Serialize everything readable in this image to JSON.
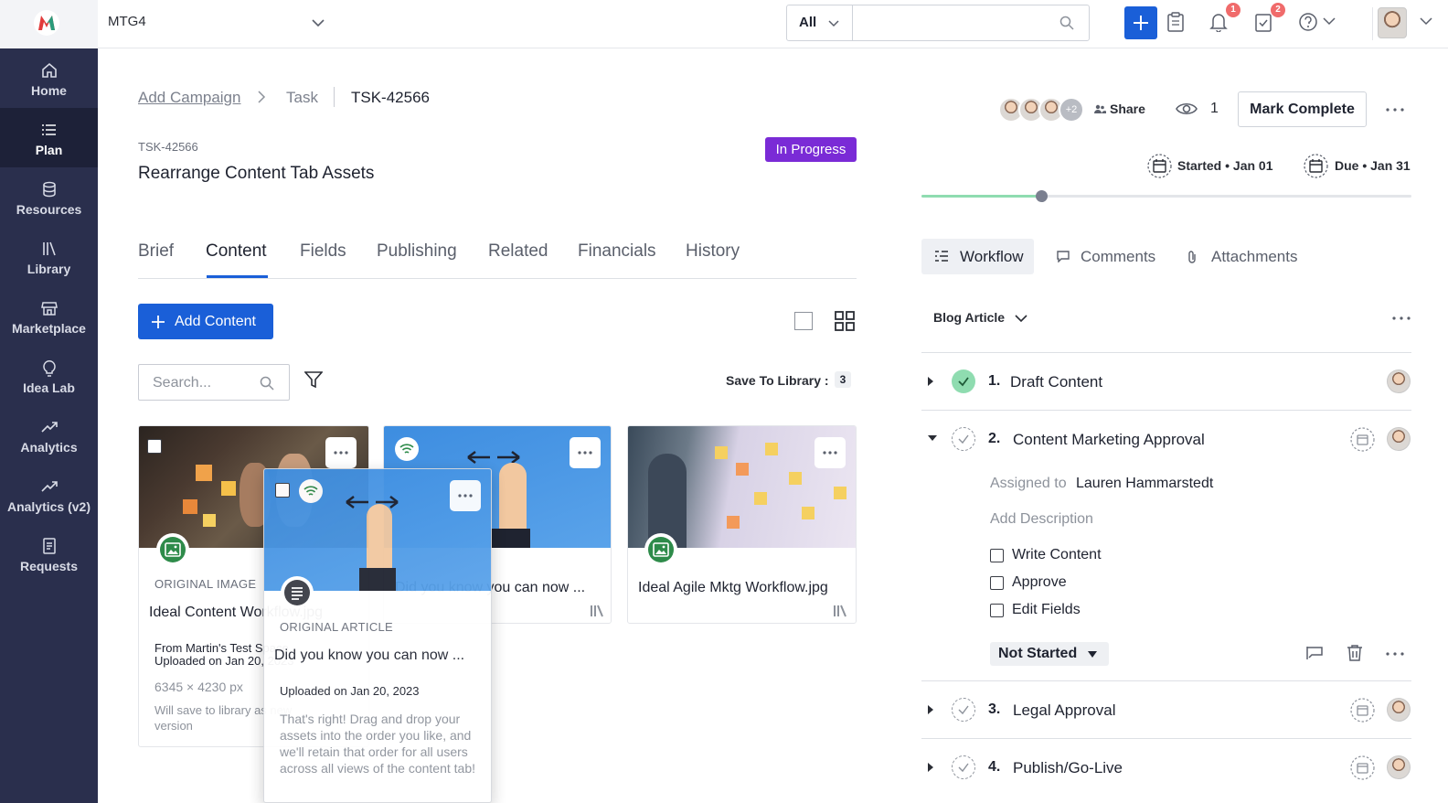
{
  "topbar": {
    "workspace": "MTG4",
    "search_scope": "All",
    "search_placeholder": "",
    "notifications_count": "1",
    "tasks_count": "2"
  },
  "sidebar": {
    "items": [
      {
        "label": "Home",
        "icon": "home-icon"
      },
      {
        "label": "Plan",
        "icon": "list-icon",
        "active": true
      },
      {
        "label": "Resources",
        "icon": "database-icon"
      },
      {
        "label": "Library",
        "icon": "library-icon"
      },
      {
        "label": "Marketplace",
        "icon": "store-icon"
      },
      {
        "label": "Idea Lab",
        "icon": "lightbulb-icon"
      },
      {
        "label": "Analytics",
        "icon": "trend-icon"
      },
      {
        "label": "Analytics (v2)",
        "icon": "trend-icon"
      },
      {
        "label": "Requests",
        "icon": "document-icon"
      }
    ]
  },
  "breadcrumb": {
    "root": "Add Campaign",
    "middle": "Task",
    "current": "TSK-42566"
  },
  "task": {
    "id": "TSK-42566",
    "title": "Rearrange Content Tab Assets",
    "status": "In Progress"
  },
  "tabs": [
    "Brief",
    "Content",
    "Fields",
    "Publishing",
    "Related",
    "Financials",
    "History"
  ],
  "active_tab": "Content",
  "content": {
    "add_button": "Add Content",
    "search_placeholder": "Search...",
    "save_to_library_label": "Save To Library :",
    "save_to_library_count": "3"
  },
  "cards": [
    {
      "kind": "ORIGINAL IMAGE",
      "name": "Ideal Content Workflow.jpg",
      "from": "From Martin's Test Space",
      "uploaded": "Uploaded on Jan 20, 2023",
      "dimensions": "6345 × 4230 px",
      "note": "Will save to library as new version"
    },
    {
      "kind": "ORIGINAL ARTICLE",
      "name": "Did you know you can now ..."
    },
    {
      "name": "Ideal Agile Mktg Workflow.jpg"
    }
  ],
  "drag_card": {
    "kind": "ORIGINAL ARTICLE",
    "name": "Did you know you can now ...",
    "uploaded": "Uploaded on Jan 20, 2023",
    "description": "That's right! Drag and drop your assets into the order you like, and we'll retain that order for all users across all views of the content tab!"
  },
  "header_right": {
    "extra_people": "+2",
    "share": "Share",
    "watchers": "1",
    "mark_complete": "Mark Complete",
    "started": "Started • Jan 01",
    "due": "Due • Jan 31",
    "progress": 0.245
  },
  "right_tabs": [
    "Workflow",
    "Comments",
    "Attachments"
  ],
  "workflow": {
    "template": "Blog Article",
    "steps": [
      {
        "num": "1.",
        "title": "Draft Content",
        "done": true
      },
      {
        "num": "2.",
        "title": "Content Marketing Approval",
        "done": false,
        "expanded": true
      },
      {
        "num": "3.",
        "title": "Legal Approval",
        "done": false
      },
      {
        "num": "4.",
        "title": "Publish/Go-Live",
        "done": false
      }
    ],
    "assigned_label": "Assigned to",
    "assignee": "Lauren Hammarstedt",
    "add_description": "Add Description",
    "checklist": [
      "Write Content",
      "Approve",
      "Edit Fields"
    ],
    "step_status": "Not Started"
  },
  "colors": {
    "sidebar": "#2a2f4d",
    "primary": "#1a5fd8",
    "status_badge": "#7a2bd6",
    "done_check": "#8fdcb0"
  }
}
